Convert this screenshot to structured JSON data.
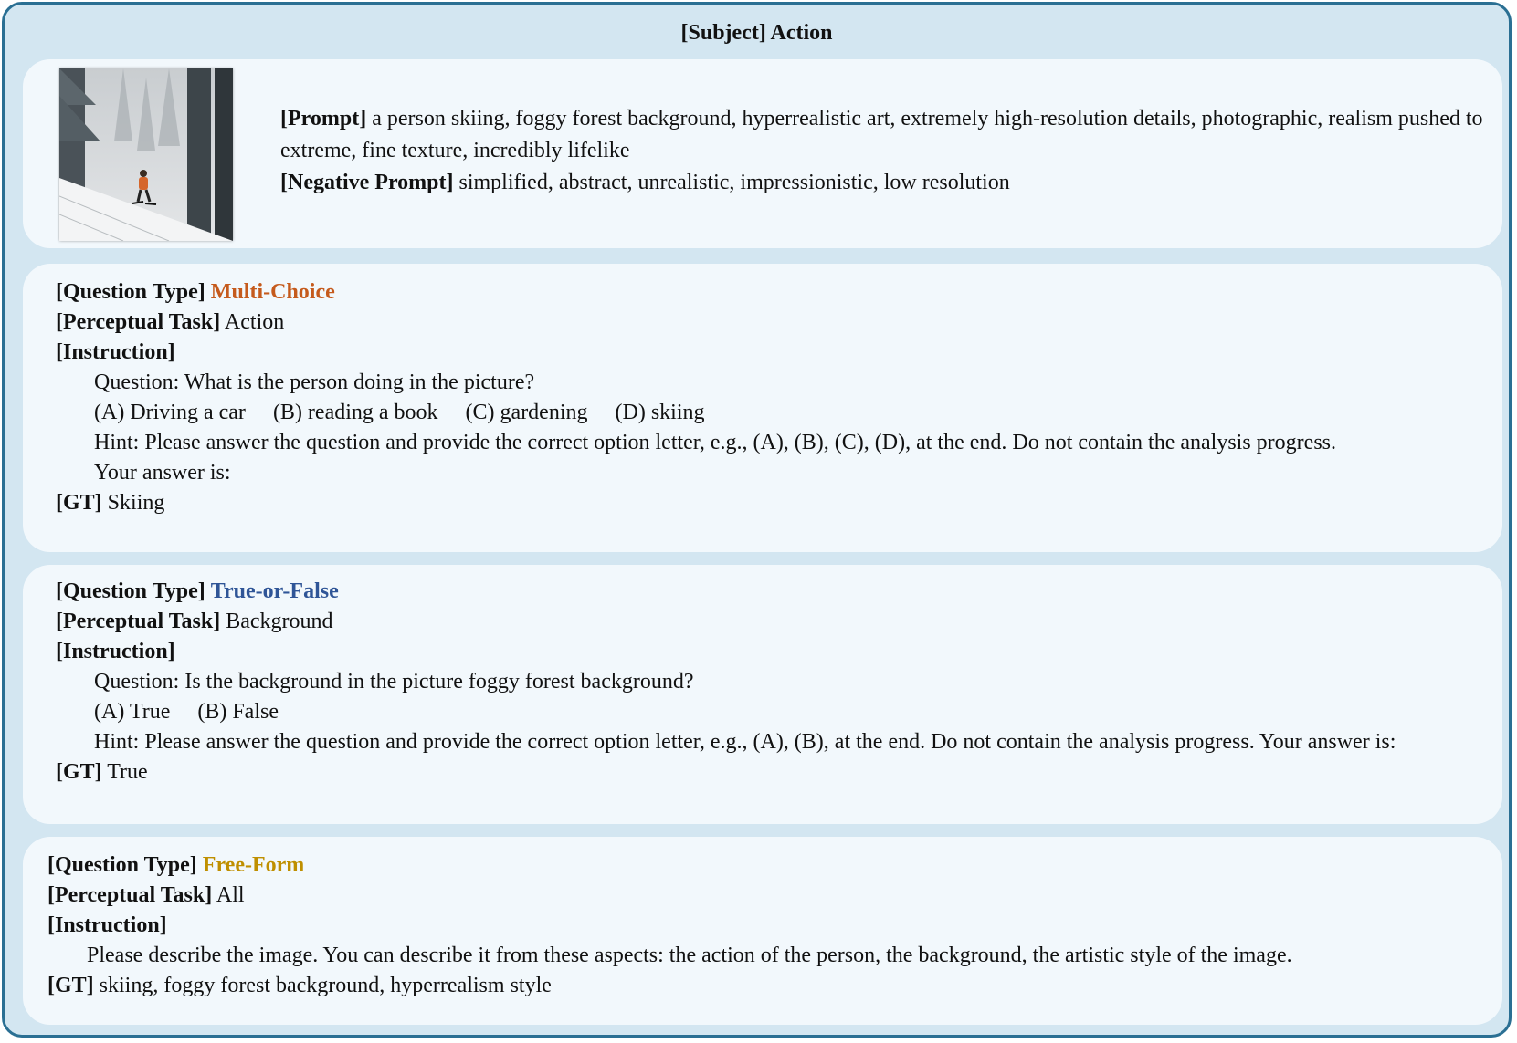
{
  "title": "[Subject] Action",
  "colors": {
    "frame_border": "#2a6f93",
    "frame_bg": "#d3e6f1",
    "card_bg": "#f2f8fc",
    "multi_choice": "#c55a1c",
    "true_false": "#2f5597",
    "free_form": "#bf8f00"
  },
  "prompt_card": {
    "image_icon": "skier-in-foggy-forest-image",
    "prompt_label": "[Prompt]",
    "prompt_text": " a person skiing, foggy forest background, hyperrealistic art, extremely high-resolution details, photographic, realism pushed to extreme, fine texture, incredibly lifelike",
    "negative_label": "[Negative Prompt]",
    "negative_text": " simplified, abstract, unrealistic, impressionistic, low resolution"
  },
  "labels": {
    "question_type": "[Question Type]",
    "perceptual_task": "[Perceptual Task]",
    "instruction": "[Instruction]",
    "gt": "[GT]"
  },
  "multi_choice": {
    "type": "Multi-Choice",
    "task": " Action",
    "question": "Question: What is the person doing in the picture?",
    "options": [
      "(A)  Driving a car",
      "(B) reading a book",
      "(C) gardening",
      "(D) skiing"
    ],
    "hint": "Hint: Please answer the question and provide the correct option letter, e.g., (A), (B), (C), (D), at the end. Do not contain the analysis progress.",
    "answer_prompt": "Your answer is:",
    "gt": " Skiing"
  },
  "true_false": {
    "type": "True-or-False",
    "task": " Background",
    "question": "Question: Is the background in the picture foggy forest background?",
    "options": [
      "(A)  True",
      "(B) False"
    ],
    "hint": "Hint: Please answer the question and provide the correct option letter, e.g., (A), (B), at the end. Do not contain the analysis progress. Your answer is:",
    "gt": " True"
  },
  "free_form": {
    "type": "Free-Form",
    "task": " All",
    "question": "Please describe the image. You can describe it from these aspects: the action of the person, the background, the artistic style of the image.",
    "gt": " skiing, foggy forest background, hyperrealism style"
  }
}
